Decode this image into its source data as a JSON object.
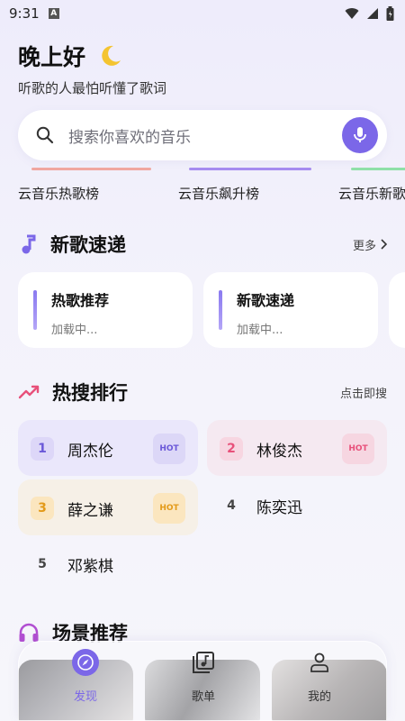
{
  "status_bar": {
    "time": "9:31",
    "notif_icon": "a-icon"
  },
  "header": {
    "greeting": "晚上好",
    "subtitle": "听歌的人最怕听懂了歌词"
  },
  "search": {
    "placeholder": "搜索你喜欢的音乐"
  },
  "charts": [
    {
      "label": "云音乐热歌榜",
      "color": "#f0a7a0"
    },
    {
      "label": "云音乐飙升榜",
      "color": "#a68cf0"
    },
    {
      "label": "云音乐新歌",
      "color": "#8fe0a8"
    }
  ],
  "new_songs": {
    "title": "新歌速递",
    "more": "更多",
    "cards": [
      {
        "title": "热歌推荐",
        "status": "加载中..."
      },
      {
        "title": "新歌速递",
        "status": "加载中..."
      }
    ]
  },
  "hot_search": {
    "title": "热搜排行",
    "hint": "点击即搜",
    "items": [
      {
        "rank": "1",
        "name": "周杰伦",
        "badge": "HOT"
      },
      {
        "rank": "2",
        "name": "林俊杰",
        "badge": "HOT"
      },
      {
        "rank": "3",
        "name": "薛之谦",
        "badge": "HOT"
      },
      {
        "rank": "4",
        "name": "陈奕迅"
      },
      {
        "rank": "5",
        "name": "邓紫棋"
      }
    ]
  },
  "scenes": {
    "title": "场景推荐"
  },
  "nav": [
    {
      "label": "发现",
      "icon": "compass-icon",
      "active": true
    },
    {
      "label": "歌单",
      "icon": "playlist-icon",
      "active": false
    },
    {
      "label": "我的",
      "icon": "user-icon",
      "active": false
    }
  ],
  "colors": {
    "accent": "#7b67e8",
    "hot_pink": "#e8507a",
    "gold": "#e39a18"
  }
}
